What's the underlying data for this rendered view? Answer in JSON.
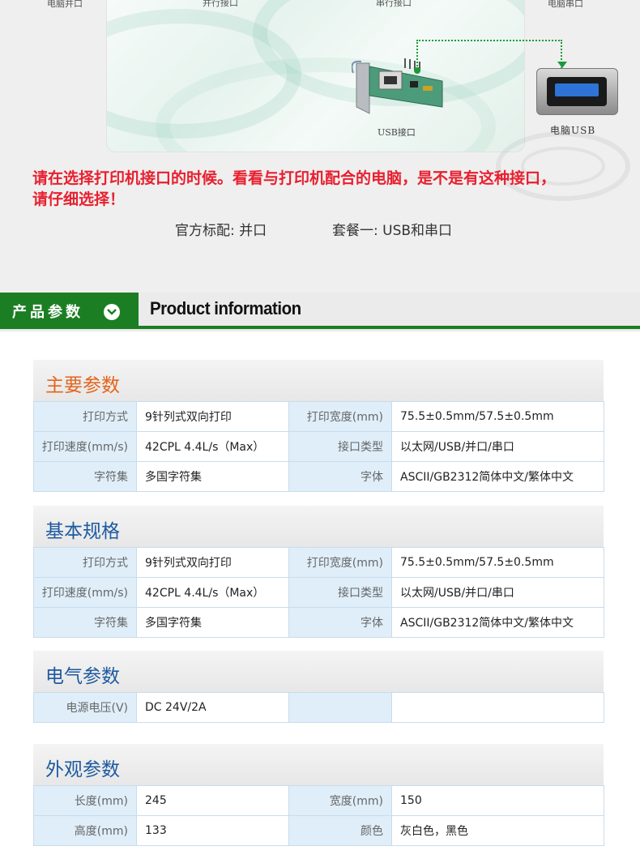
{
  "top": {
    "labels": {
      "parallel_pc": "电脑并口",
      "parallel_port": "并行接口",
      "serial_port": "串行接口",
      "serial_pc": "电脑串口"
    },
    "usb_interface_label": "USB接口",
    "pc_usb_label": "电脑USB",
    "warning_line1": "请在选择打印机接口的时候。看看与打印机配合的电脑，是不是有这种接口，",
    "warning_line2": "请仔细选择！",
    "option_standard": "官方标配: 并口",
    "option_package1": "套餐一: USB和串口",
    "accent_green": "#1b7e23",
    "warning_red": "#e8202f"
  },
  "header": {
    "tab_label": "产品参数",
    "tab_icon": "chevron-down-icon",
    "title_en": "Product information"
  },
  "groups": [
    {
      "title": "主要参数",
      "title_color": "#e4641b",
      "rows": [
        [
          "打印方式",
          "9针列式双向打印",
          "打印宽度(mm)",
          "75.5±0.5mm/57.5±0.5mm"
        ],
        [
          "打印速度(mm/s)",
          "42CPL 4.4L/s（Max）",
          "接口类型",
          "以太网/USB/并口/串口"
        ],
        [
          "字符集",
          "多国字符集",
          "字体",
          "ASCII/GB2312简体中文/繁体中文"
        ]
      ]
    },
    {
      "title": "基本规格",
      "title_color": "#1d5aa0",
      "rows": [
        [
          "打印方式",
          "9针列式双向打印",
          "打印宽度(mm)",
          "75.5±0.5mm/57.5±0.5mm"
        ],
        [
          "打印速度(mm/s)",
          "42CPL 4.4L/s（Max）",
          "接口类型",
          "以太网/USB/并口/串口"
        ],
        [
          "字符集",
          "多国字符集",
          "字体",
          "ASCII/GB2312简体中文/繁体中文"
        ]
      ]
    },
    {
      "title": "电气参数",
      "title_color": "#1d5aa0",
      "rows": [
        [
          "电源电压(V)",
          "DC 24V/2A",
          "",
          ""
        ]
      ]
    },
    {
      "title": "外观参数",
      "title_color": "#1d5aa0",
      "rows": [
        [
          "长度(mm)",
          "245",
          "宽度(mm)",
          "150"
        ],
        [
          "高度(mm)",
          "133",
          "颜色",
          "灰白色，黑色"
        ]
      ]
    }
  ]
}
